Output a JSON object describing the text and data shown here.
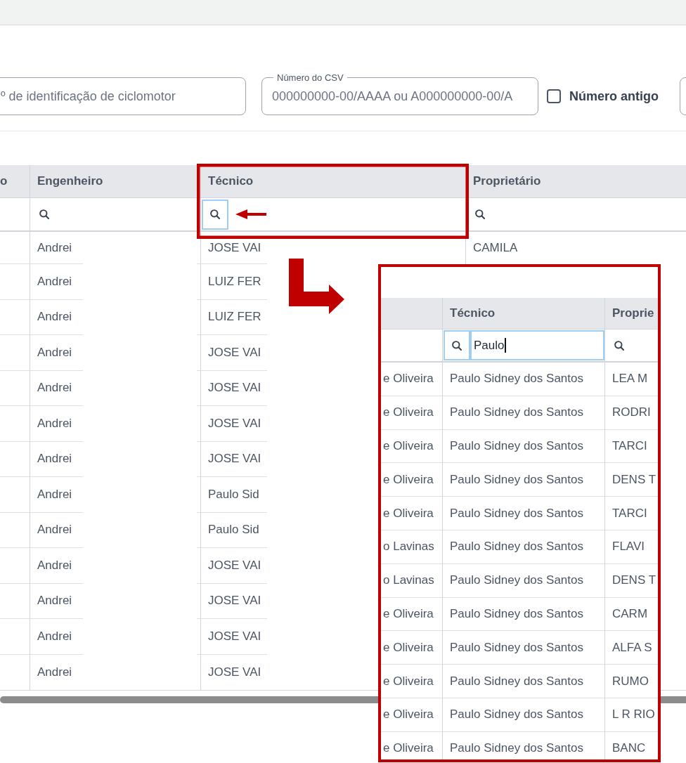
{
  "filters": [
    {
      "kind": "text",
      "placeholder": "º de identificação de ciclomotor"
    },
    {
      "kind": "text",
      "label": "Número do CSV",
      "placeholder": "000000000-00/AAAA ou A000000000-00/A"
    },
    {
      "kind": "checkbox",
      "label": "Número antigo",
      "checked": false
    },
    {
      "kind": "text"
    }
  ],
  "table": {
    "columns": [
      {
        "label": "o"
      },
      {
        "label": "Engenheiro",
        "filter": {
          "button_focused": false,
          "input_focused": false
        }
      },
      {
        "label": "Técnico",
        "filter": {
          "button_focused": true,
          "input_focused": false
        }
      },
      {
        "label": "Proprietário",
        "filter": {
          "button_focused": false,
          "input_focused": false
        }
      }
    ],
    "rows": [
      {
        "engenheiro": "Andrei",
        "tecnico": "JOSE VAI",
        "proprietario": "CAMILA"
      },
      {
        "engenheiro": "Andrei",
        "tecnico": "LUIZ FER"
      },
      {
        "engenheiro": "Andrei",
        "tecnico": "LUIZ FER"
      },
      {
        "engenheiro": "Andrei",
        "tecnico": "JOSE VAI"
      },
      {
        "engenheiro": "Andrei",
        "tecnico": "JOSE VAI"
      },
      {
        "engenheiro": "Andrei",
        "tecnico": "JOSE VAI"
      },
      {
        "engenheiro": "Andrei",
        "tecnico": "JOSE VAI"
      },
      {
        "engenheiro": "Andrei",
        "tecnico": "Paulo Sid"
      },
      {
        "engenheiro": "Andrei",
        "tecnico": "Paulo Sid"
      },
      {
        "engenheiro": "Andrei",
        "tecnico": "JOSE VAI"
      },
      {
        "engenheiro": "Andrei",
        "tecnico": "JOSE VAI"
      },
      {
        "engenheiro": "Andrei",
        "tecnico": "JOSE VAI"
      },
      {
        "engenheiro": "Andrei",
        "tecnico": "JOSE VAI"
      }
    ]
  },
  "zoom_inset": {
    "columns": [
      {
        "label": "Técnico",
        "filter": {
          "button_focused": true,
          "input_focused": true,
          "value": "Paulo"
        }
      },
      {
        "label": "Proprie",
        "filter": {
          "button_focused": false,
          "input_focused": false
        }
      }
    ],
    "rows": [
      {
        "column_1": "e Oliveira",
        "tecnico": "Paulo Sidney dos Santos",
        "proprietario": "LEA M"
      },
      {
        "column_1": "e Oliveira",
        "tecnico": "Paulo Sidney dos Santos",
        "proprietario": "RODRI"
      },
      {
        "column_1": "e Oliveira",
        "tecnico": "Paulo Sidney dos Santos",
        "proprietario": "TARCI"
      },
      {
        "column_1": "e Oliveira",
        "tecnico": "Paulo Sidney dos Santos",
        "proprietario": "DENS T"
      },
      {
        "column_1": "e Oliveira",
        "tecnico": "Paulo Sidney dos Santos",
        "proprietario": "TARCI"
      },
      {
        "column_1": "o Lavinas",
        "tecnico": "Paulo Sidney dos Santos",
        "proprietario": "FLAVI"
      },
      {
        "column_1": "o Lavinas",
        "tecnico": "Paulo Sidney dos Santos",
        "proprietario": "DENS T"
      },
      {
        "column_1": "e Oliveira",
        "tecnico": "Paulo Sidney dos Santos",
        "proprietario": "CARM"
      },
      {
        "column_1": "e Oliveira",
        "tecnico": "Paulo Sidney dos Santos",
        "proprietario": "ALFA S"
      },
      {
        "column_1": "e Oliveira",
        "tecnico": "Paulo Sidney dos Santos",
        "proprietario": "RUMO"
      },
      {
        "column_1": "e Oliveira",
        "tecnico": "Paulo Sidney dos Santos",
        "proprietario": "L R RIO"
      },
      {
        "column_1": "e Oliveira",
        "tecnico": "Paulo Sidney dos Santos",
        "proprietario": "BANC"
      }
    ]
  }
}
